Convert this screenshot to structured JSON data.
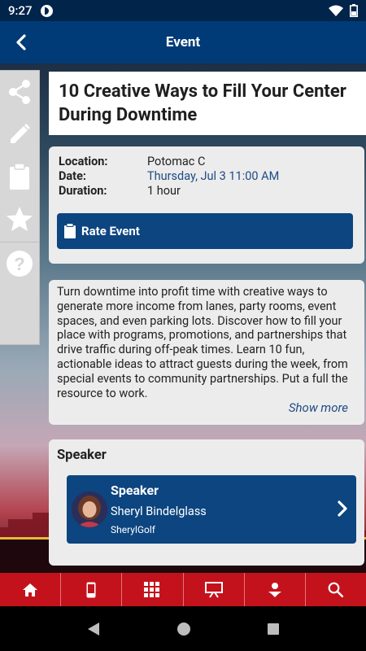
{
  "status_bar": {
    "time": "9:27"
  },
  "app_bar": {
    "title": "Event"
  },
  "event": {
    "title": "10 Creative Ways to Fill Your Center During Downtime",
    "location_label": "Location:",
    "location_value": "Potomac C",
    "date_label": "Date:",
    "date_value": "Thursday, Jul 3 11:00 AM",
    "duration_label": "Duration:",
    "duration_value": "1 hour",
    "rate_button": "Rate Event",
    "description": "Turn downtime into profit time with creative ways to generate more income from lanes, party rooms, event spaces, and even parking lots. Discover how to fill your place with programs, promotions, and partnerships that drive traffic during off-peak times. Learn 10 fun, actionable ideas to attract guests during the week, from special events to community partnerships. Put a full the resource to work.",
    "show_more": "Show more"
  },
  "speaker_section": {
    "heading": "Speaker",
    "speaker": {
      "role": "Speaker",
      "name": "Sheryl Bindelglass",
      "org": "SherylGolf"
    }
  },
  "side_toolbar": [
    "share-icon",
    "edit-icon",
    "clipboard-icon",
    "star-icon",
    "help-icon"
  ],
  "bottom_nav": [
    "home-icon",
    "mobile-icon",
    "qr-code-icon",
    "presentation-icon",
    "exhibitor-icon",
    "search-icon"
  ],
  "colors": {
    "app_bar": "#003b77",
    "status_bar": "#00244a",
    "button": "#0c4580",
    "bottom_nav": "#c4121c",
    "link": "#1d4b85"
  }
}
